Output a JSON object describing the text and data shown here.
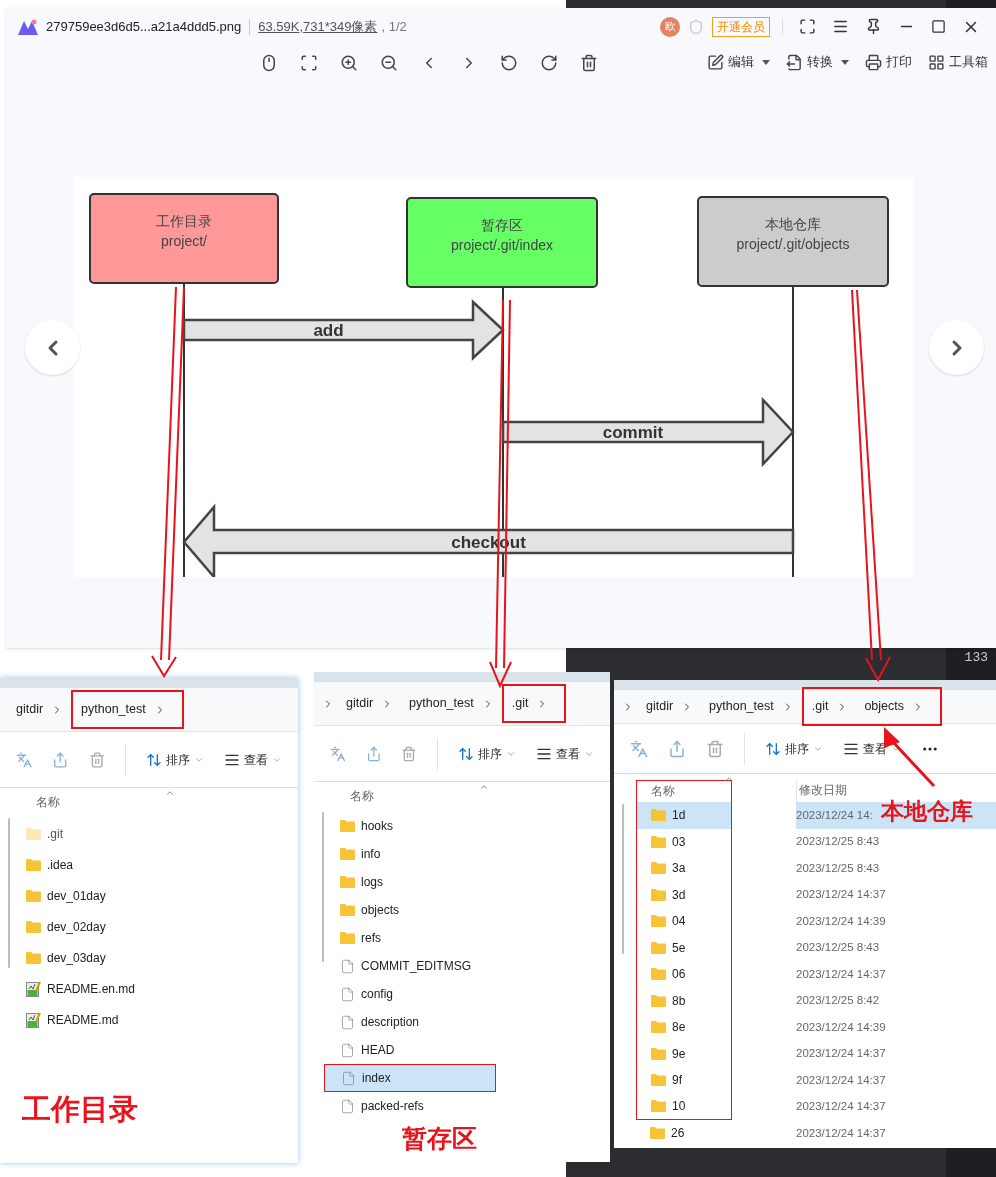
{
  "viewer": {
    "filename": "279759ee3d6d5...a21a4ddd5.png",
    "size": "63.59K",
    "dimensions": ",731*349像素",
    "page": ", 1/2",
    "avatar": "欧",
    "vip_button": "开通会员",
    "tools": [
      {
        "label": "编辑",
        "kind": "edit",
        "dropdown": true
      },
      {
        "label": "转换",
        "kind": "convert",
        "dropdown": true
      },
      {
        "label": "打印",
        "kind": "print",
        "dropdown": false
      },
      {
        "label": "工具箱",
        "kind": "toolbox",
        "dropdown": false
      }
    ]
  },
  "diagram": {
    "boxes": [
      {
        "title": "工作目录",
        "path": "project/",
        "color": "#ff9999"
      },
      {
        "title": "暂存区",
        "path": "project/.git/index",
        "color": "#66ff66"
      },
      {
        "title": "本地仓库",
        "path": "project/.git/objects",
        "color": "#cccccc"
      }
    ],
    "arrows": [
      {
        "label": "add",
        "points_left": false
      },
      {
        "label": "commit",
        "points_left": false
      },
      {
        "label": "checkout",
        "points_left": true
      }
    ]
  },
  "explorers": [
    {
      "breadcrumb": [
        {
          "label": "gitdir",
          "highlighted": false
        },
        {
          "label": "python_test",
          "highlighted": true
        }
      ],
      "sort": "排序",
      "view": "查看",
      "columns": [
        "名称"
      ],
      "caption": "工作目录",
      "files": [
        {
          "name": ".git",
          "kind": "folder",
          "hidden": true,
          "selected": false,
          "highlighted": false
        },
        {
          "name": ".idea",
          "kind": "folder",
          "hidden": false,
          "selected": false,
          "highlighted": false
        },
        {
          "name": "dev_01day",
          "kind": "folder",
          "hidden": false,
          "selected": false,
          "highlighted": false
        },
        {
          "name": "dev_02day",
          "kind": "folder",
          "hidden": false,
          "selected": false,
          "highlighted": false
        },
        {
          "name": "dev_03day",
          "kind": "folder",
          "hidden": false,
          "selected": false,
          "highlighted": false
        },
        {
          "name": "README.en.md",
          "kind": "markdown",
          "hidden": false,
          "selected": false,
          "highlighted": false
        },
        {
          "name": "README.md",
          "kind": "markdown",
          "hidden": false,
          "selected": false,
          "highlighted": false
        }
      ]
    },
    {
      "breadcrumb": [
        {
          "label": "gitdir",
          "highlighted": false
        },
        {
          "label": "python_test",
          "highlighted": false
        },
        {
          "label": ".git",
          "highlighted": true
        }
      ],
      "leading_chevron": true,
      "sort": "排序",
      "view": "查看",
      "columns": [
        "名称"
      ],
      "caption": "暂存区",
      "files": [
        {
          "name": "hooks",
          "kind": "folder",
          "hidden": false,
          "selected": false,
          "highlighted": false
        },
        {
          "name": "info",
          "kind": "folder",
          "hidden": false,
          "selected": false,
          "highlighted": false
        },
        {
          "name": "logs",
          "kind": "folder",
          "hidden": false,
          "selected": false,
          "highlighted": false
        },
        {
          "name": "objects",
          "kind": "folder",
          "hidden": false,
          "selected": false,
          "highlighted": false
        },
        {
          "name": "refs",
          "kind": "folder",
          "hidden": false,
          "selected": false,
          "highlighted": false
        },
        {
          "name": "COMMIT_EDITMSG",
          "kind": "file",
          "hidden": false,
          "selected": false,
          "highlighted": false
        },
        {
          "name": "config",
          "kind": "file",
          "hidden": false,
          "selected": false,
          "highlighted": false
        },
        {
          "name": "description",
          "kind": "file",
          "hidden": false,
          "selected": false,
          "highlighted": false
        },
        {
          "name": "HEAD",
          "kind": "file",
          "hidden": false,
          "selected": false,
          "highlighted": false
        },
        {
          "name": "index",
          "kind": "file",
          "hidden": false,
          "selected": true,
          "highlighted": true
        },
        {
          "name": "packed-refs",
          "kind": "file",
          "hidden": false,
          "selected": false,
          "highlighted": false
        }
      ]
    },
    {
      "breadcrumb": [
        {
          "label": "gitdir",
          "highlighted": false
        },
        {
          "label": "python_test",
          "highlighted": false
        },
        {
          "label": ".git",
          "highlighted": true
        },
        {
          "label": "objects",
          "highlighted": true
        }
      ],
      "leading_chevron": true,
      "sort": "排序",
      "view": "查看",
      "more": true,
      "columns": [
        "名称",
        "修改日期"
      ],
      "caption": "本地仓库",
      "files": [
        {
          "name": "1d",
          "kind": "folder",
          "date": "2023/12/24 14:",
          "hidden": false,
          "selected": true,
          "highlighted": true
        },
        {
          "name": "03",
          "kind": "folder",
          "date": "2023/12/25 8:43",
          "hidden": false,
          "selected": false,
          "highlighted": true
        },
        {
          "name": "3a",
          "kind": "folder",
          "date": "2023/12/25 8:43",
          "hidden": false,
          "selected": false,
          "highlighted": true
        },
        {
          "name": "3d",
          "kind": "folder",
          "date": "2023/12/24 14:37",
          "hidden": false,
          "selected": false,
          "highlighted": true
        },
        {
          "name": "04",
          "kind": "folder",
          "date": "2023/12/24 14:39",
          "hidden": false,
          "selected": false,
          "highlighted": true
        },
        {
          "name": "5e",
          "kind": "folder",
          "date": "2023/12/25 8:43",
          "hidden": false,
          "selected": false,
          "highlighted": true
        },
        {
          "name": "06",
          "kind": "folder",
          "date": "2023/12/24 14:37",
          "hidden": false,
          "selected": false,
          "highlighted": true
        },
        {
          "name": "8b",
          "kind": "folder",
          "date": "2023/12/25 8:42",
          "hidden": false,
          "selected": false,
          "highlighted": true
        },
        {
          "name": "8e",
          "kind": "folder",
          "date": "2023/12/24 14:39",
          "hidden": false,
          "selected": false,
          "highlighted": true
        },
        {
          "name": "9e",
          "kind": "folder",
          "date": "2023/12/24 14:37",
          "hidden": false,
          "selected": false,
          "highlighted": true
        },
        {
          "name": "9f",
          "kind": "folder",
          "date": "2023/12/24 14:37",
          "hidden": false,
          "selected": false,
          "highlighted": true
        },
        {
          "name": "10",
          "kind": "folder",
          "date": "2023/12/24 14:37",
          "hidden": false,
          "selected": false,
          "highlighted": true
        },
        {
          "name": "26",
          "kind": "folder",
          "date": "2023/12/24 14:37",
          "hidden": false,
          "selected": false,
          "highlighted": false
        }
      ]
    }
  ],
  "editor": {
    "line_numbers": [
      "133"
    ]
  }
}
